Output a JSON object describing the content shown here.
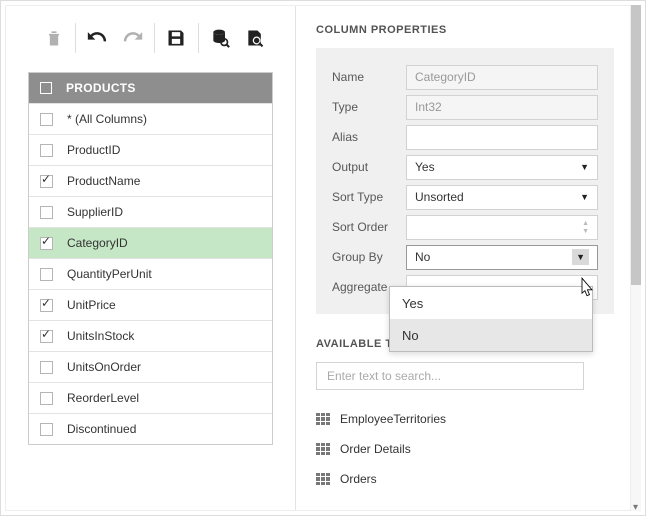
{
  "toolbar": {
    "delete": "delete",
    "undo": "undo",
    "redo": "redo",
    "save": "save",
    "dbview": "dbview",
    "preview": "preview"
  },
  "table": {
    "title": "PRODUCTS",
    "rows": [
      {
        "label": "* (All Columns)",
        "checked": false,
        "selected": false
      },
      {
        "label": "ProductID",
        "checked": false,
        "selected": false
      },
      {
        "label": "ProductName",
        "checked": true,
        "selected": false
      },
      {
        "label": "SupplierID",
        "checked": false,
        "selected": false
      },
      {
        "label": "CategoryID",
        "checked": true,
        "selected": true
      },
      {
        "label": "QuantityPerUnit",
        "checked": false,
        "selected": false
      },
      {
        "label": "UnitPrice",
        "checked": true,
        "selected": false
      },
      {
        "label": "UnitsInStock",
        "checked": true,
        "selected": false
      },
      {
        "label": "UnitsOnOrder",
        "checked": false,
        "selected": false
      },
      {
        "label": "ReorderLevel",
        "checked": false,
        "selected": false
      },
      {
        "label": "Discontinued",
        "checked": false,
        "selected": false
      }
    ]
  },
  "props": {
    "section_title": "COLUMN PROPERTIES",
    "name": {
      "label": "Name",
      "value": "CategoryID"
    },
    "type": {
      "label": "Type",
      "value": "Int32"
    },
    "alias": {
      "label": "Alias",
      "value": ""
    },
    "output": {
      "label": "Output",
      "value": "Yes"
    },
    "sort_type": {
      "label": "Sort Type",
      "value": "Unsorted"
    },
    "sort_order": {
      "label": "Sort Order",
      "value": ""
    },
    "group_by": {
      "label": "Group By",
      "value": "No"
    },
    "aggregate": {
      "label": "Aggregate",
      "value": ""
    }
  },
  "groupby_options": [
    "Yes",
    "No"
  ],
  "groupby_selected": "No",
  "available": {
    "title": "AVAILABLE TABLES AND VIEWS",
    "search_placeholder": "Enter text to search...",
    "items": [
      "EmployeeTerritories",
      "Order Details",
      "Orders"
    ]
  }
}
